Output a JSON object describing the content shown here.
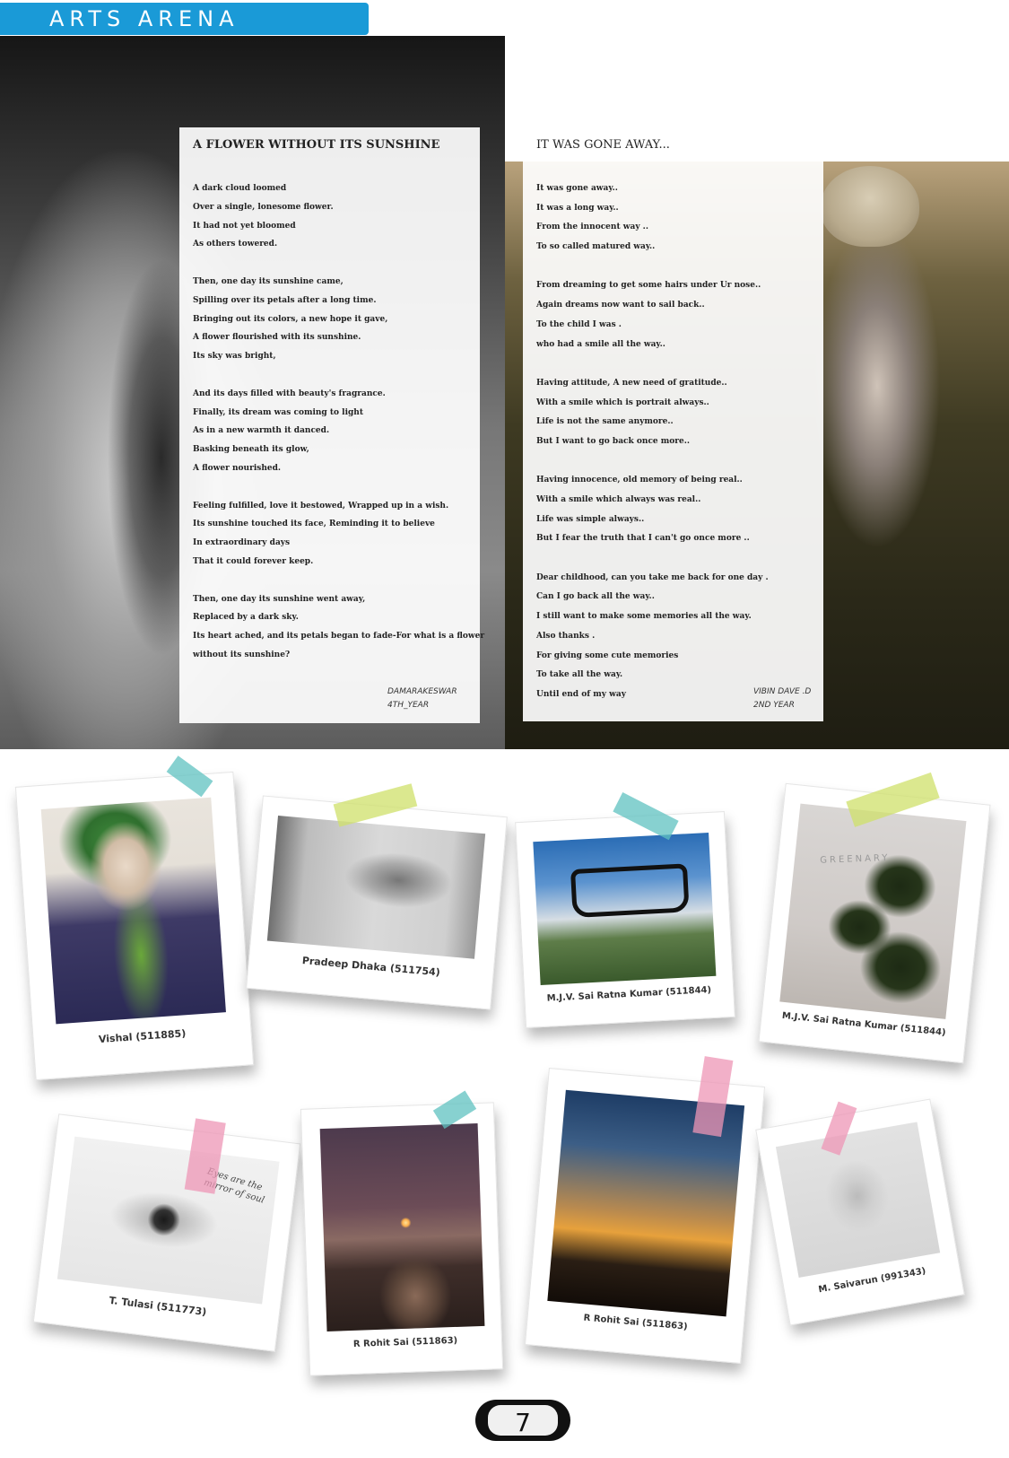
{
  "header": {
    "title": "ARTS ARENA"
  },
  "poem1": {
    "title": "A FLOWER WITHOUT ITS SUNSHINE",
    "lines": [
      "A dark cloud loomed",
      "Over a single, lonesome flower.",
      "It had not yet bloomed",
      "As others towered.",
      "",
      "Then, one day its sunshine came,",
      "Spilling over its petals after a long time.",
      "Bringing out its colors, a new hope it gave,",
      "A flower flourished with its sunshine.",
      "Its sky was bright,",
      "",
      "And its days filled with beauty's fragrance.",
      "Finally, its dream was coming to light",
      "As in a new warmth it danced.",
      "Basking beneath its glow,",
      "A flower nourished.",
      "",
      "Feeling fulfilled, love it bestowed, Wrapped up in a wish.",
      "Its sunshine touched its face, Reminding it to believe",
      "In extraordinary days",
      "That it could forever keep.",
      "",
      "Then, one day its sunshine went away,",
      "Replaced by a dark sky.",
      "Its heart ached, and its petals began to fade-For what is a flower",
      "without its sunshine?"
    ],
    "author_name": "DAMARAKESWAR",
    "author_year": "4TH_YEAR"
  },
  "poem2": {
    "title": "IT WAS GONE AWAY...",
    "lines": [
      "It was gone away..",
      "It was a long way..",
      "From the innocent way ..",
      "To so called matured way..",
      "",
      "From dreaming to get some hairs under Ur nose..",
      "Again dreams now want to sail back..",
      "To the child I  was .",
      "who had a smile all the way..",
      "",
      "Having attitude, A new need of gratitude..",
      "With a smile which is portrait always..",
      "Life is not the same anymore..",
      "But I want to go back once more..",
      "",
      "Having innocence, old memory of being real..",
      "With a smile which always was real..",
      "Life was simple always..",
      "But I fear the truth that I can't go once more ..",
      "",
      "Dear childhood, can you take me back for one day .",
      "Can I go back all the way..",
      "I still want to make some memories all the way.",
      "Also thanks .",
      "For giving some cute memories",
      "To take all the way.",
      "Until end of my way"
    ],
    "author_name": "VIBIN DAVE .D",
    "author_year": "2ND YEAR"
  },
  "gallery": [
    {
      "caption": "Vishal (511885)",
      "subject": "joker-drawing"
    },
    {
      "caption": "Pradeep Dhaka (511754)",
      "subject": "revolver-sketch"
    },
    {
      "caption": "M.J.V. Sai Ratna Kumar (511844)",
      "subject": "glasses-photo"
    },
    {
      "caption": "M.J.V. Sai Ratna Kumar (511844)",
      "subject": "plant-photo"
    },
    {
      "caption": "T. Tulasi (511773)",
      "subject": "eye-feather-sketch"
    },
    {
      "caption": "R Rohit Sai (511863)",
      "subject": "sunset-flower-photo"
    },
    {
      "caption": "R Rohit Sai (511863)",
      "subject": "palm-sunset-photo"
    },
    {
      "caption": "M. Saivarun (991343)",
      "subject": "mickey-sketch"
    }
  ],
  "pic_texts": {
    "eye_sketch_note_1": "Eyes are the",
    "eye_sketch_note_2": "mirror of soul",
    "plant_watermark": "GREENARY"
  },
  "page_number": "7"
}
